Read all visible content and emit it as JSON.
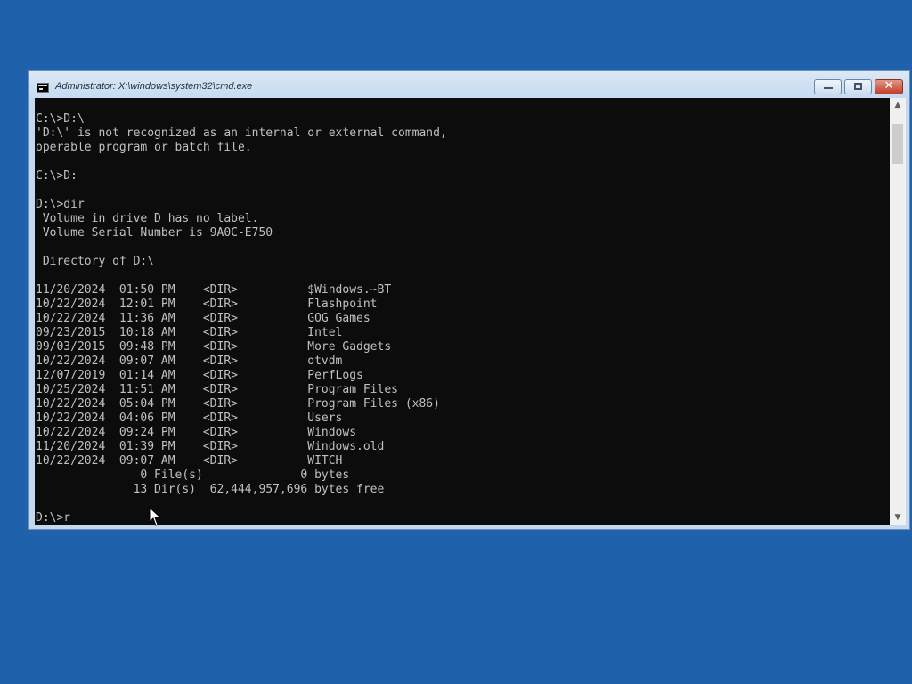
{
  "window": {
    "title": "Administrator: X:\\windows\\system32\\cmd.exe",
    "icon": "cmd-icon",
    "controls": {
      "minimize": "minimize-icon",
      "maximize": "maximize-icon",
      "close": "close-icon"
    }
  },
  "console": {
    "lines": [
      "C:\\>D:\\",
      "'D:\\' is not recognized as an internal or external command,",
      "operable program or batch file.",
      "",
      "C:\\>D:",
      "",
      "D:\\>dir",
      " Volume in drive D has no label.",
      " Volume Serial Number is 9A0C-E750",
      "",
      " Directory of D:\\",
      "",
      "11/20/2024  01:50 PM    <DIR>          $Windows.~BT",
      "10/22/2024  12:01 PM    <DIR>          Flashpoint",
      "10/22/2024  11:36 AM    <DIR>          GOG Games",
      "09/23/2015  10:18 AM    <DIR>          Intel",
      "09/03/2015  09:48 PM    <DIR>          More Gadgets",
      "10/22/2024  09:07 AM    <DIR>          otvdm",
      "12/07/2019  01:14 AM    <DIR>          PerfLogs",
      "10/25/2024  11:51 AM    <DIR>          Program Files",
      "10/22/2024  05:04 PM    <DIR>          Program Files (x86)",
      "10/22/2024  04:06 PM    <DIR>          Users",
      "10/22/2024  09:24 PM    <DIR>          Windows",
      "11/20/2024  01:39 PM    <DIR>          Windows.old",
      "10/22/2024  09:07 AM    <DIR>          WITCH",
      "               0 File(s)              0 bytes",
      "              13 Dir(s)  62,444,957,696 bytes free",
      "",
      "D:\\>r"
    ]
  },
  "colors": {
    "desktop": "#1f62ab",
    "console_background": "#0c0c0c",
    "console_text": "#c0c0c0"
  },
  "icons": {
    "scroll_up": "scroll-up-icon",
    "scroll_down": "scroll-down-icon",
    "mouse_pointer": "mouse-pointer-icon"
  }
}
